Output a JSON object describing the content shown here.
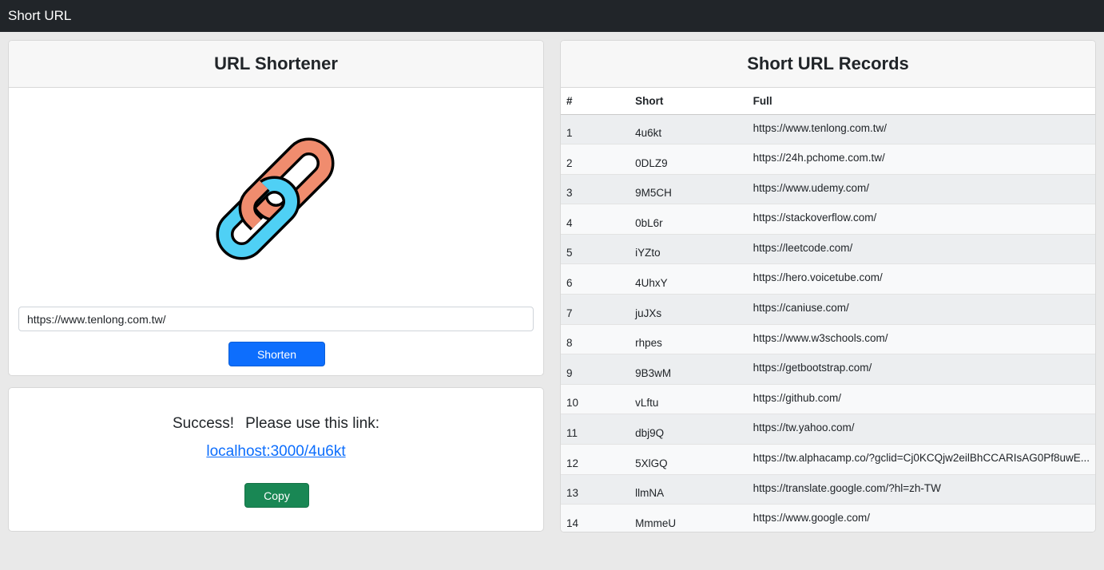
{
  "navbar": {
    "brand": "Short URL"
  },
  "shortener": {
    "title": "URL Shortener",
    "logo_icon": "chain-link-icon",
    "input_value": "https://www.tenlong.com.tw/",
    "button_label": "Shorten",
    "colors": {
      "link_left": "#4fd0f5",
      "link_right": "#f08c6e",
      "button": "#0d6efd"
    }
  },
  "result": {
    "success_text": "Success!",
    "message_text": "Please use this link:",
    "link_text": "localhost:3000/4u6kt",
    "copy_label": "Copy",
    "colors": {
      "link": "#0d6efd",
      "copy_button": "#198754"
    }
  },
  "records": {
    "title": "Short URL Records",
    "columns": [
      "#",
      "Short",
      "Full"
    ],
    "rows": [
      {
        "num": "1",
        "short": "4u6kt",
        "full": "https://www.tenlong.com.tw/"
      },
      {
        "num": "2",
        "short": "0DLZ9",
        "full": "https://24h.pchome.com.tw/"
      },
      {
        "num": "3",
        "short": "9M5CH",
        "full": "https://www.udemy.com/"
      },
      {
        "num": "4",
        "short": "0bL6r",
        "full": "https://stackoverflow.com/"
      },
      {
        "num": "5",
        "short": "iYZto",
        "full": "https://leetcode.com/"
      },
      {
        "num": "6",
        "short": "4UhxY",
        "full": "https://hero.voicetube.com/"
      },
      {
        "num": "7",
        "short": "juJXs",
        "full": "https://caniuse.com/"
      },
      {
        "num": "8",
        "short": "rhpes",
        "full": "https://www.w3schools.com/"
      },
      {
        "num": "9",
        "short": "9B3wM",
        "full": "https://getbootstrap.com/"
      },
      {
        "num": "10",
        "short": "vLftu",
        "full": "https://github.com/"
      },
      {
        "num": "11",
        "short": "dbj9Q",
        "full": "https://tw.yahoo.com/"
      },
      {
        "num": "12",
        "short": "5XlGQ",
        "full": "https://tw.alphacamp.co/?gclid=Cj0KCQjw2eilBhCCARIsAG0Pf8uwE..."
      },
      {
        "num": "13",
        "short": "llmNA",
        "full": "https://translate.google.com/?hl=zh-TW"
      },
      {
        "num": "14",
        "short": "MmmeU",
        "full": "https://www.google.com/"
      }
    ]
  }
}
